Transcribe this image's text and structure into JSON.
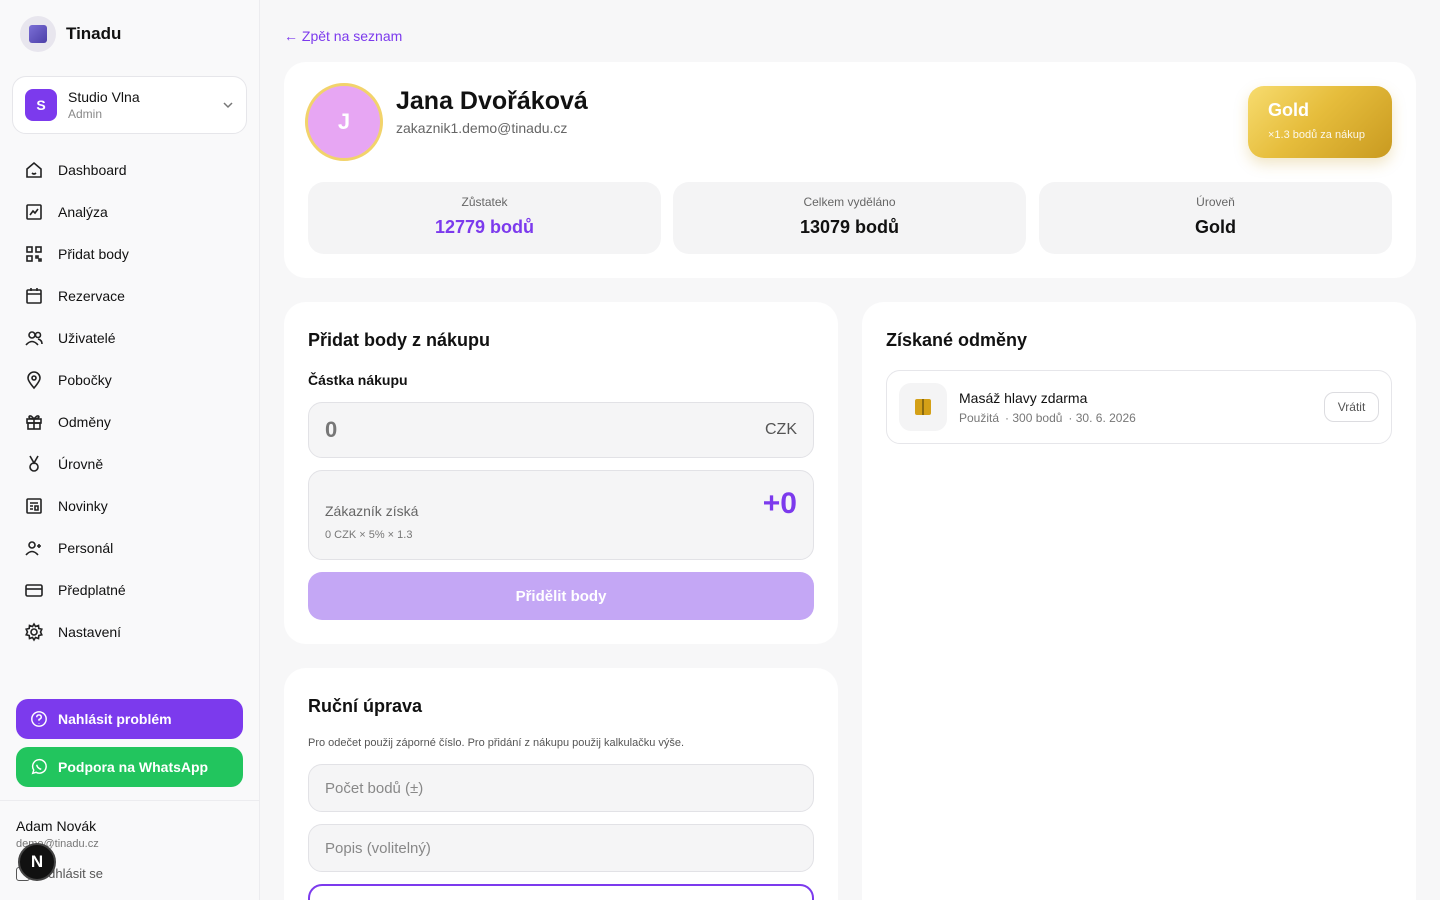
{
  "brand": {
    "name": "Tinadu"
  },
  "org": {
    "initial": "S",
    "name": "Studio Vlna",
    "role": "Admin"
  },
  "nav": [
    {
      "label": "Dashboard",
      "icon": "home-icon"
    },
    {
      "label": "Analýza",
      "icon": "chart-icon"
    },
    {
      "label": "Přidat body",
      "icon": "qr-icon"
    },
    {
      "label": "Rezervace",
      "icon": "calendar-icon"
    },
    {
      "label": "Uživatelé",
      "icon": "users-icon"
    },
    {
      "label": "Pobočky",
      "icon": "pin-icon"
    },
    {
      "label": "Odměny",
      "icon": "gift-icon"
    },
    {
      "label": "Úrovně",
      "icon": "medal-icon"
    },
    {
      "label": "Novinky",
      "icon": "news-icon"
    },
    {
      "label": "Personál",
      "icon": "user-plus-icon"
    },
    {
      "label": "Předplatné",
      "icon": "card-icon"
    },
    {
      "label": "Nastavení",
      "icon": "gear-icon"
    }
  ],
  "sidebar_buttons": {
    "report": "Nahlásit problém",
    "whatsapp": "Podpora na WhatsApp"
  },
  "user": {
    "name": "Adam Novák",
    "email": "demo@tinadu.cz",
    "logout": "Odhlásit se",
    "bubble": "N"
  },
  "back_link": "← Zpět na seznam",
  "customer": {
    "initial": "J",
    "name": "Jana Dvořáková",
    "email": "zakaznik1.demo@tinadu.cz",
    "tier": "Gold",
    "tier_multiplier": "×1.3 bodů za nákup"
  },
  "stats": [
    {
      "label": "Zůstatek",
      "value": "12779 bodů"
    },
    {
      "label": "Celkem vyděláno",
      "value": "13079 bodů"
    },
    {
      "label": "Úroveň",
      "value": "Gold"
    }
  ],
  "purchase": {
    "title": "Přidat body z nákupu",
    "amount_label": "Částka nákupu",
    "amount_placeholder": "0",
    "currency": "CZK",
    "gain_label": "Zákazník získá",
    "gain_formula": "0 CZK × 5% × 1.3",
    "gain_value": "+0",
    "submit": "Přidělit body"
  },
  "manual": {
    "title": "Ruční úprava",
    "hint": "Pro odečet použij záporné číslo. Pro přidání z nákupu použij kalkulačku výše.",
    "points_placeholder": "Počet bodů (±)",
    "desc_placeholder": "Popis (volitelný)"
  },
  "rewards": {
    "title": "Získané odměny",
    "items": [
      {
        "name": "Masáž hlavy zdarma",
        "status": "Použitá",
        "points": "· 300 bodů",
        "date": "· 30. 6. 2026",
        "action": "Vrátit"
      }
    ]
  },
  "colors": {
    "accent": "#7c3aed",
    "whatsapp": "#22c55e",
    "gold": "#e6bd3c"
  }
}
